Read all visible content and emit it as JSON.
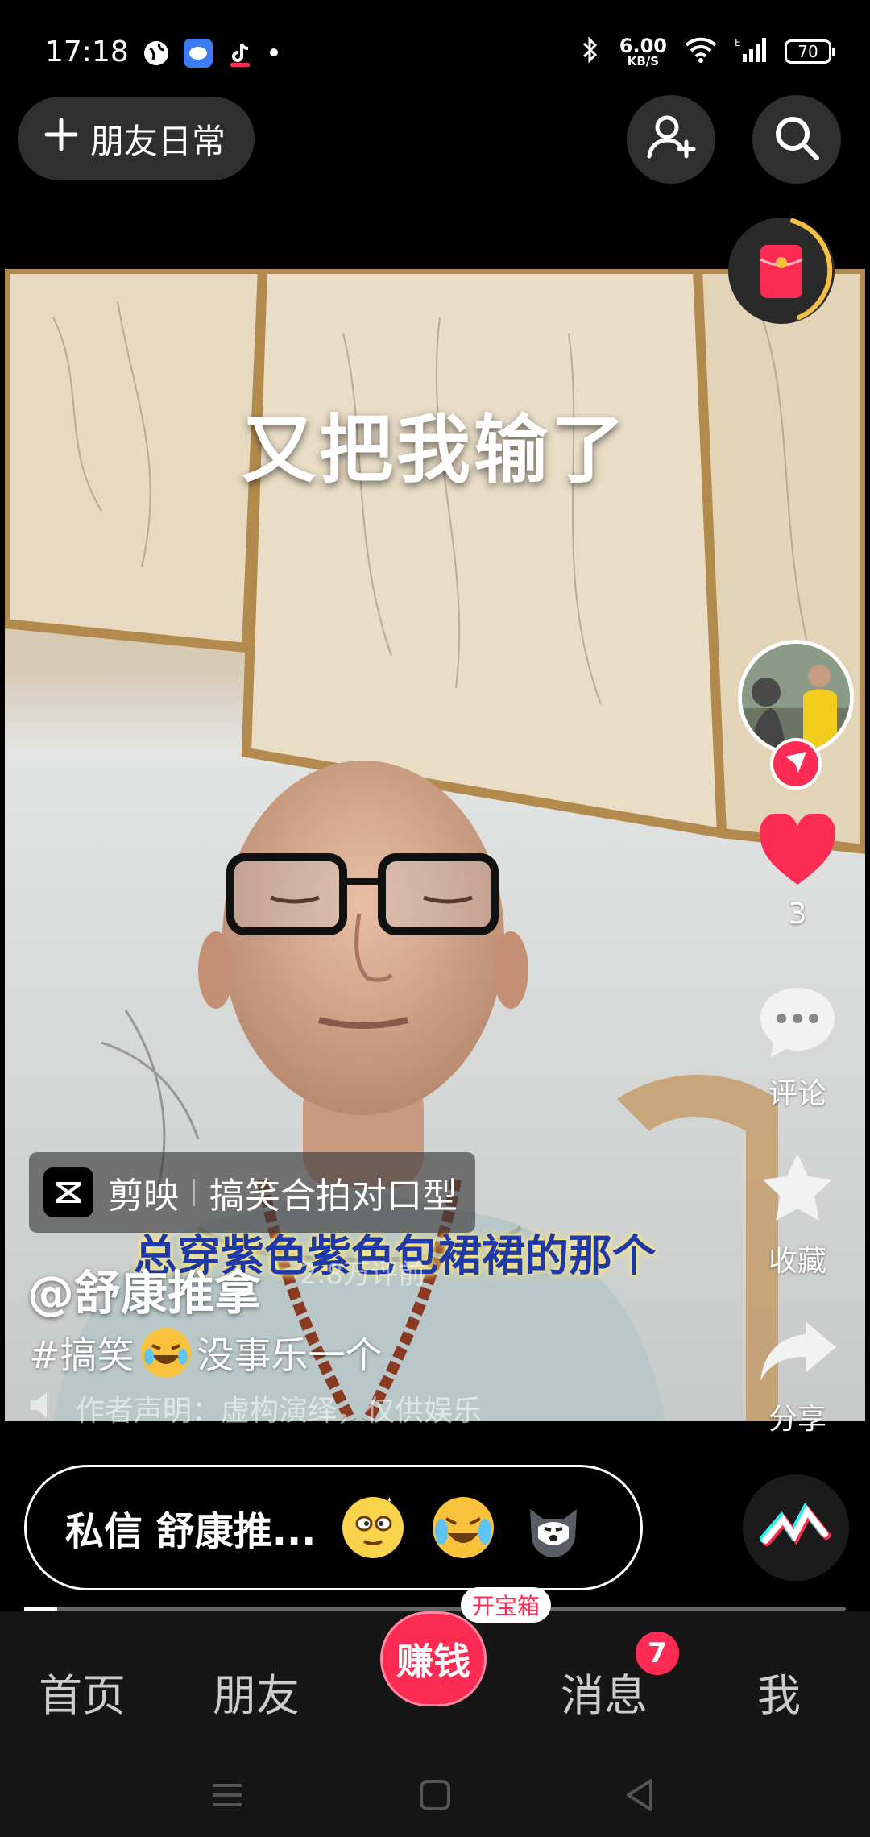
{
  "status_bar": {
    "time": "17:18",
    "net_speed_value": "6.00",
    "net_speed_unit": "KB/S",
    "battery": "70"
  },
  "top_bar": {
    "friends_daily_label": "朋友日常",
    "add_friend_icon": "add-friend-icon",
    "search_icon": "search-icon"
  },
  "video": {
    "caption": "又把我输了",
    "subtitle": "总穿紫色紫色包裙裙的那个",
    "watermark": "2.8万评前"
  },
  "actions": {
    "like_count": "3",
    "comment_label": "评论",
    "favorite_label": "收藏",
    "share_label": "分享"
  },
  "info": {
    "capcut_label": "剪映",
    "template_label": "搞笑合拍对口型",
    "author_name": "@舒康推拿",
    "hashtag": "#搞笑",
    "description": "没事乐一个",
    "author_note": "作者声明：虚构演绎，仅供娱乐"
  },
  "dm_bar": {
    "text": "私信 舒康推..."
  },
  "playback": {
    "progress": 0.04
  },
  "bottom_nav": {
    "home": "首页",
    "friends": "朋友",
    "earn": "赚钱",
    "treasure": "开宝箱",
    "messages": "消息",
    "messages_badge": "7",
    "me": "我"
  },
  "colors": {
    "accent": "#fe2c55",
    "nav_bg": "#161616"
  }
}
